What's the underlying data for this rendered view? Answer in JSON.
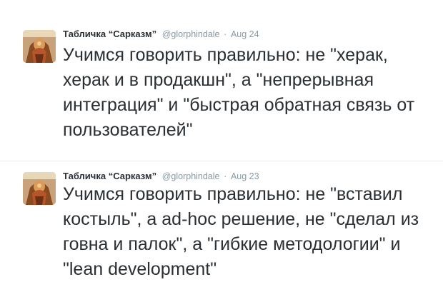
{
  "tweets": [
    {
      "fullname": "Табличка “Сарказм”",
      "username": "@glorphindale",
      "separator": "·",
      "timestamp": "Aug 24",
      "text": "Учимся говорить правильно: не \"херак, херак и в продакшн\", а \"непрерывная интеграция\" и \"быстрая обратная связь от пользователей\"",
      "avatar": "user-avatar-icon"
    },
    {
      "fullname": "Табличка “Сарказм”",
      "username": "@glorphindale",
      "separator": "·",
      "timestamp": "Aug 23",
      "text": "Учимся говорить правильно: не \"вставил костыль\", а ad-hoc решение, не \"сделал из говна и палок\", а \"гибкие методологии\" и \"lean development\"",
      "avatar": "user-avatar-icon"
    }
  ],
  "colors": {
    "name": "#292f33",
    "meta": "#8899a6",
    "divider": "#e8e8e8"
  }
}
